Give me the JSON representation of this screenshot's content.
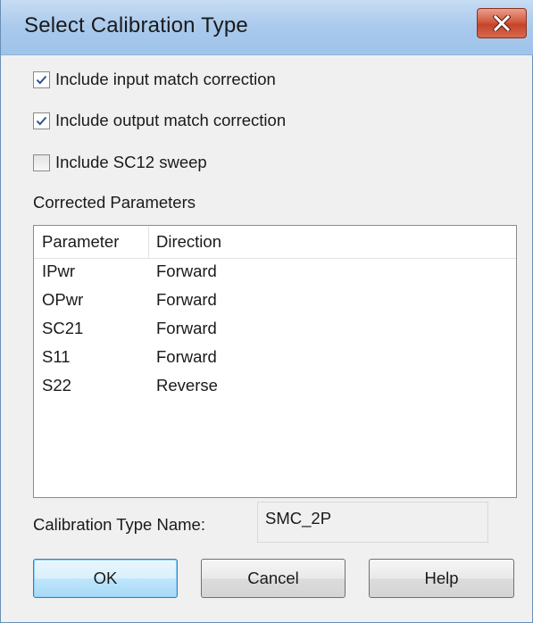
{
  "window": {
    "title": "Select Calibration Type"
  },
  "options": [
    {
      "label": "Include input match correction",
      "checked": true
    },
    {
      "label": "Include output match correction",
      "checked": true
    },
    {
      "label": "Include SC12 sweep",
      "checked": false
    }
  ],
  "corrected": {
    "section_label": "Corrected Parameters",
    "columns": [
      "Parameter",
      "Direction"
    ],
    "rows": [
      [
        "IPwr",
        "Forward"
      ],
      [
        "OPwr",
        "Forward"
      ],
      [
        "SC21",
        "Forward"
      ],
      [
        "S11",
        "Forward"
      ],
      [
        "S22",
        "Reverse"
      ]
    ]
  },
  "calibration_name": {
    "label": "Calibration Type Name:",
    "value": "SMC_2P"
  },
  "buttons": {
    "ok": "OK",
    "cancel": "Cancel",
    "help": "Help"
  }
}
